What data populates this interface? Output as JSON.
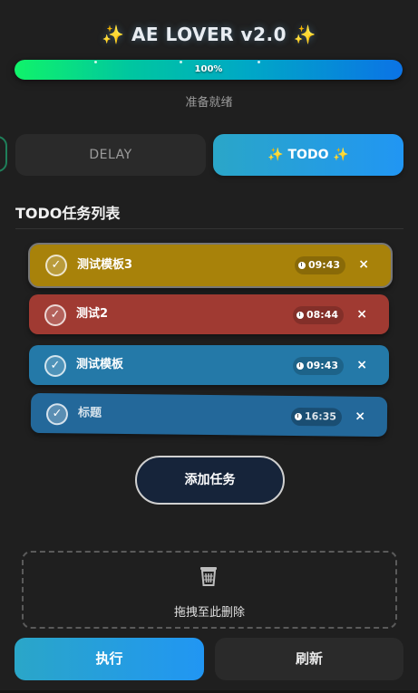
{
  "header": {
    "spark_left": "✨",
    "title": "AE LOVER v2.0",
    "spark_right": "✨"
  },
  "progress": {
    "value_percent": 100,
    "label": "100%"
  },
  "status": "准备就绪",
  "tabs": {
    "delay_label": "DELAY",
    "todo_spark_left": "✨",
    "todo_label": "TODO",
    "todo_spark_right": "✨",
    "active": "TODO"
  },
  "section_title": "TODO任务列表",
  "tasks": [
    {
      "name": "测试模板3",
      "time": "09:43",
      "color": "#a8820a",
      "check": "✓",
      "delete": "×"
    },
    {
      "name": "测试2",
      "time": "08:44",
      "color": "#a03a32",
      "check": "✓",
      "delete": "×"
    },
    {
      "name": "测试模板",
      "time": "09:43",
      "color": "#2479a8",
      "check": "✓",
      "delete": "×"
    },
    {
      "name": "标题",
      "time": "16:35",
      "color": "#23689a",
      "check": "✓",
      "delete": "×"
    }
  ],
  "add_task_label": "添加任务",
  "trash": {
    "icon": "trash-icon",
    "label": "拖拽至此删除"
  },
  "actions": {
    "run_label": "执行",
    "refresh_label": "刷新"
  },
  "colors": {
    "accent": "#2196f3",
    "background": "#1f1f1f"
  }
}
